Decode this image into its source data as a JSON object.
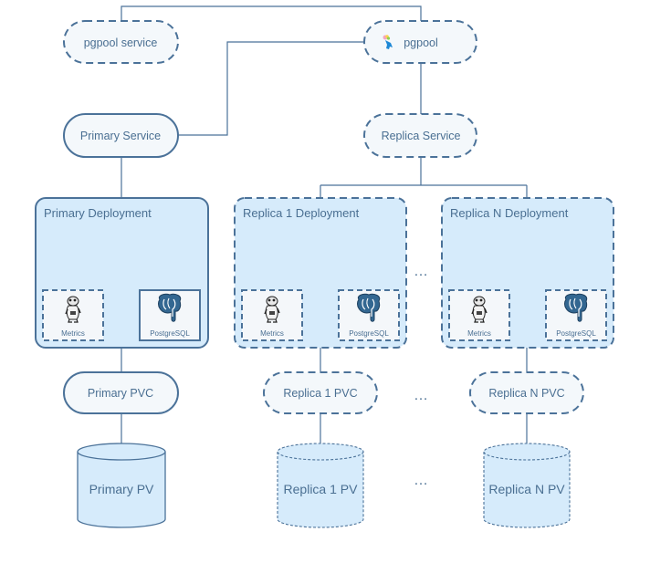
{
  "colors": {
    "stroke": "#4b7299",
    "pill_fill": "#f4f8fb",
    "box_fill": "#d6ebfb",
    "inner_fill": "#f4f7fa",
    "text": "#4a6f92"
  },
  "top": {
    "pgpool_service": "pgpool service",
    "pgpool": "pgpool",
    "pgpool_icon": "pgpool-logo-icon"
  },
  "services": {
    "primary": "Primary Service",
    "replica": "Replica Service"
  },
  "deployments": [
    {
      "title": "Primary Deployment",
      "metrics": "Metrics",
      "db": "PostgreSQL",
      "style": "solid"
    },
    {
      "title": "Replica 1 Deployment",
      "metrics": "Metrics",
      "db": "PostgreSQL",
      "style": "dashed"
    },
    {
      "title": "Replica N Deployment",
      "metrics": "Metrics",
      "db": "PostgreSQL",
      "style": "dashed"
    }
  ],
  "pvcs": [
    {
      "label": "Primary PVC",
      "style": "solid"
    },
    {
      "label": "Replica 1 PVC",
      "style": "dashed"
    },
    {
      "label": "Replica N PVC",
      "style": "dashed"
    }
  ],
  "pvs": [
    {
      "label": "Primary PV",
      "style": "solid"
    },
    {
      "label": "Replica 1 PV",
      "style": "dashed"
    },
    {
      "label": "Replica N PV",
      "style": "dashed"
    }
  ],
  "ellipsis": "…",
  "icons": {
    "metrics": "gopher-mascot-icon",
    "db": "postgresql-elephant-icon"
  }
}
